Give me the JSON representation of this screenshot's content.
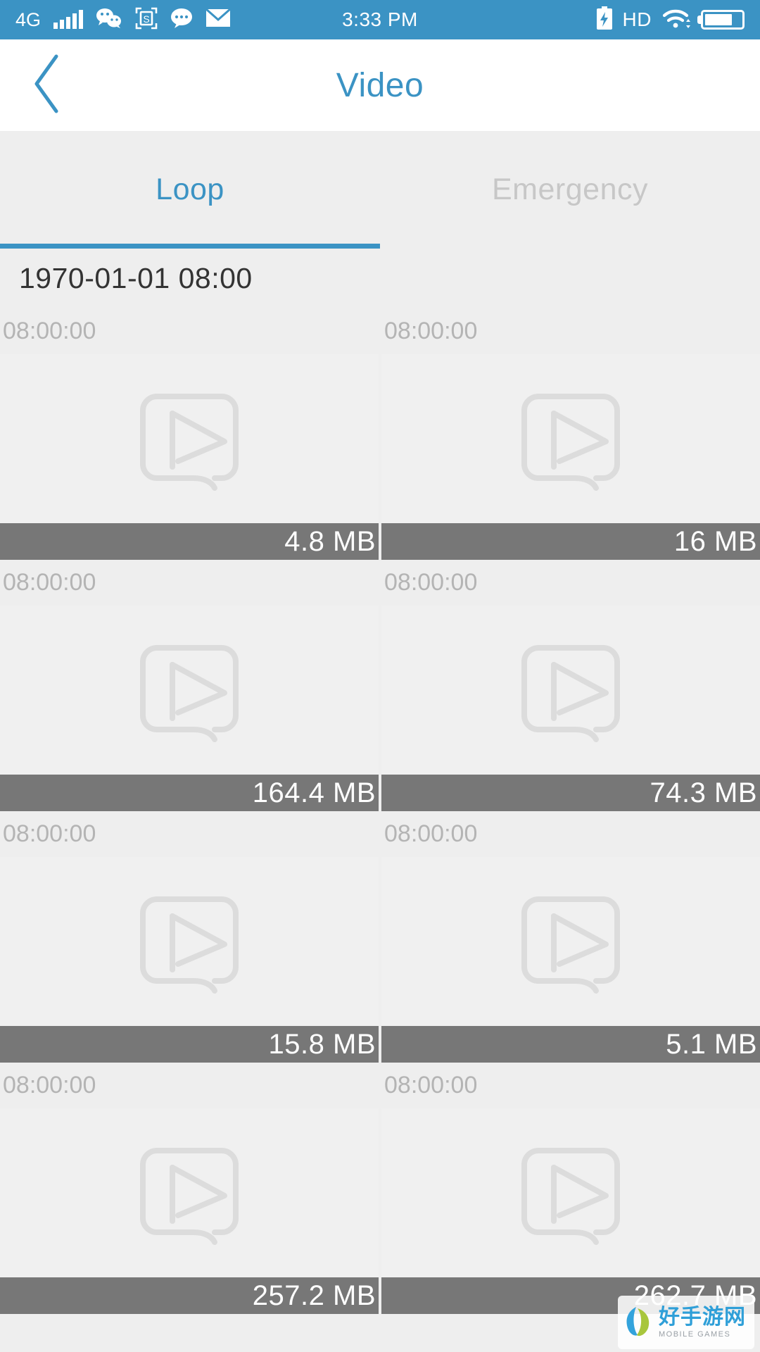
{
  "status_bar": {
    "network_type": "4G",
    "signal_icon": "signal-bars-icon",
    "app_icons": [
      "wechat-icon",
      "screenshot-s-icon",
      "chat-bubble-icon",
      "mail-icon"
    ],
    "time": "3:33 PM",
    "charging_icon": "battery-charging-icon",
    "hd_label": "HD",
    "wifi_icon": "wifi-icon",
    "battery_icon": "battery-icon",
    "bar_color": "#3b93c4",
    "text_color": "#ffffff"
  },
  "nav": {
    "back_icon": "chevron-left-icon",
    "title": "Video",
    "title_color": "#3b93c4",
    "background": "#ffffff"
  },
  "tabs": {
    "items": [
      {
        "label": "Loop",
        "active": true
      },
      {
        "label": "Emergency",
        "active": false
      }
    ],
    "active_color": "#3b93c4",
    "inactive_color": "#c7c7c7",
    "underline_color": "#3b93c4"
  },
  "list": {
    "date_header": "1970-01-01 08:00",
    "placeholder_icon": "video-play-placeholder-icon",
    "size_bar_color": "#777777",
    "thumb_color": "#f0f0f0",
    "items": [
      {
        "time": "08:00:00",
        "size": "4.8 MB"
      },
      {
        "time": "08:00:00",
        "size": "16 MB"
      },
      {
        "time": "08:00:00",
        "size": "164.4 MB"
      },
      {
        "time": "08:00:00",
        "size": "74.3 MB"
      },
      {
        "time": "08:00:00",
        "size": "15.8 MB"
      },
      {
        "time": "08:00:00",
        "size": "5.1 MB"
      },
      {
        "time": "08:00:00",
        "size": "257.2 MB"
      },
      {
        "time": "08:00:00",
        "size": "262.7 MB"
      }
    ]
  },
  "watermark": {
    "cn_text": "好手游网",
    "en_text": "MOBILE GAMES",
    "logo_icon": "leaf-logo-icon",
    "blue": "#2f9fd8",
    "green": "#a8c63c"
  }
}
